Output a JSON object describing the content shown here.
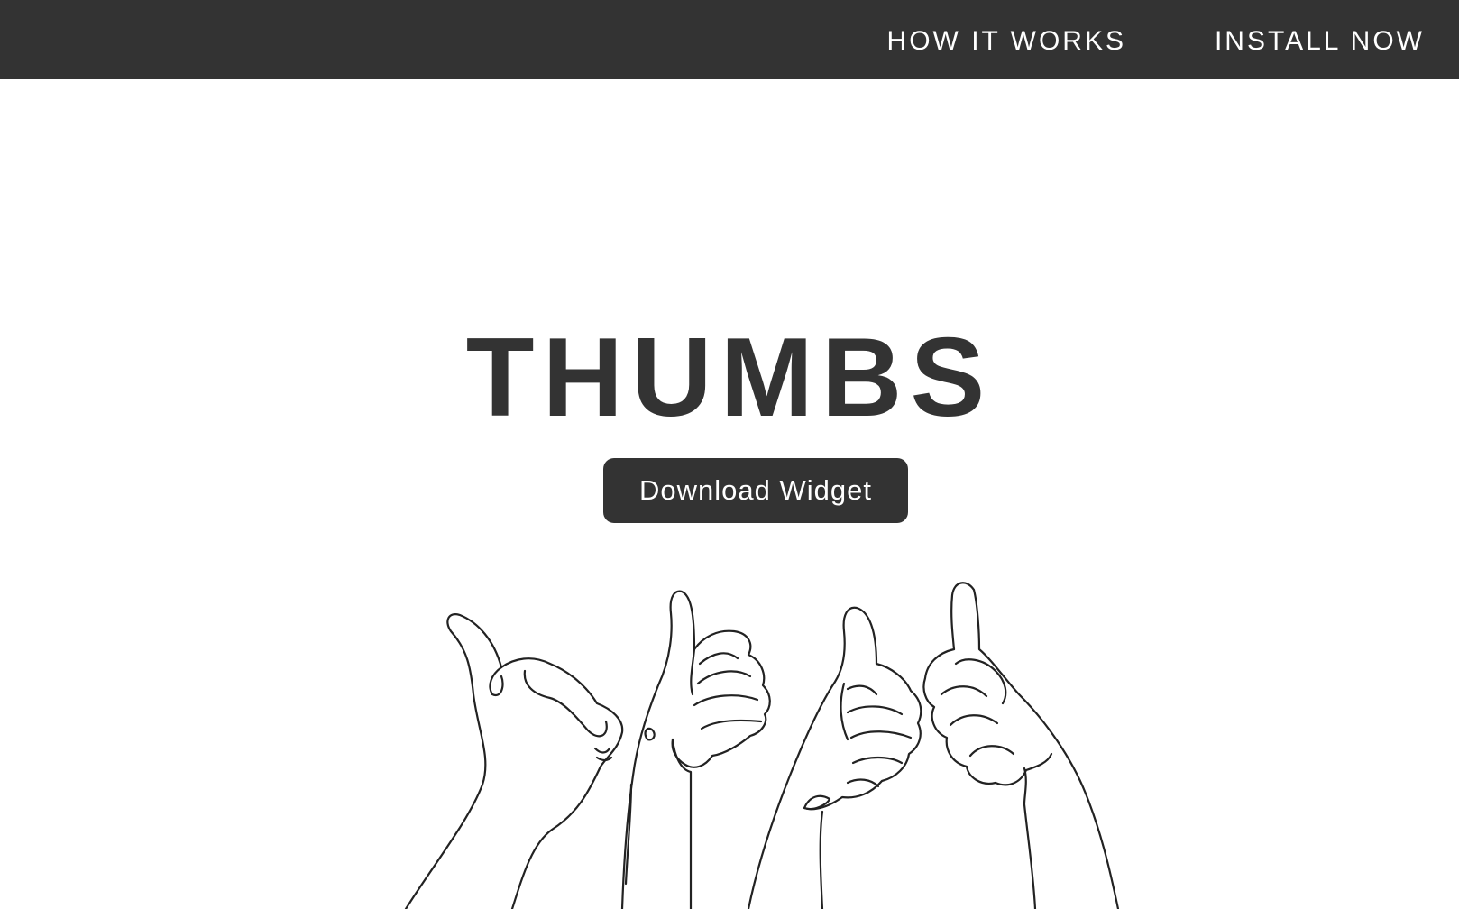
{
  "nav": {
    "how_it_works": "HOW IT WORKS",
    "install_now": "INSTALL NOW"
  },
  "hero": {
    "title": "THUMBS",
    "download_button": "Download Widget"
  },
  "illustration": {
    "icon": "thumbs-up-hands-illustration"
  },
  "colors": {
    "topbar_bg": "#333333",
    "text_dark": "#333333",
    "background": "#ffffff"
  }
}
